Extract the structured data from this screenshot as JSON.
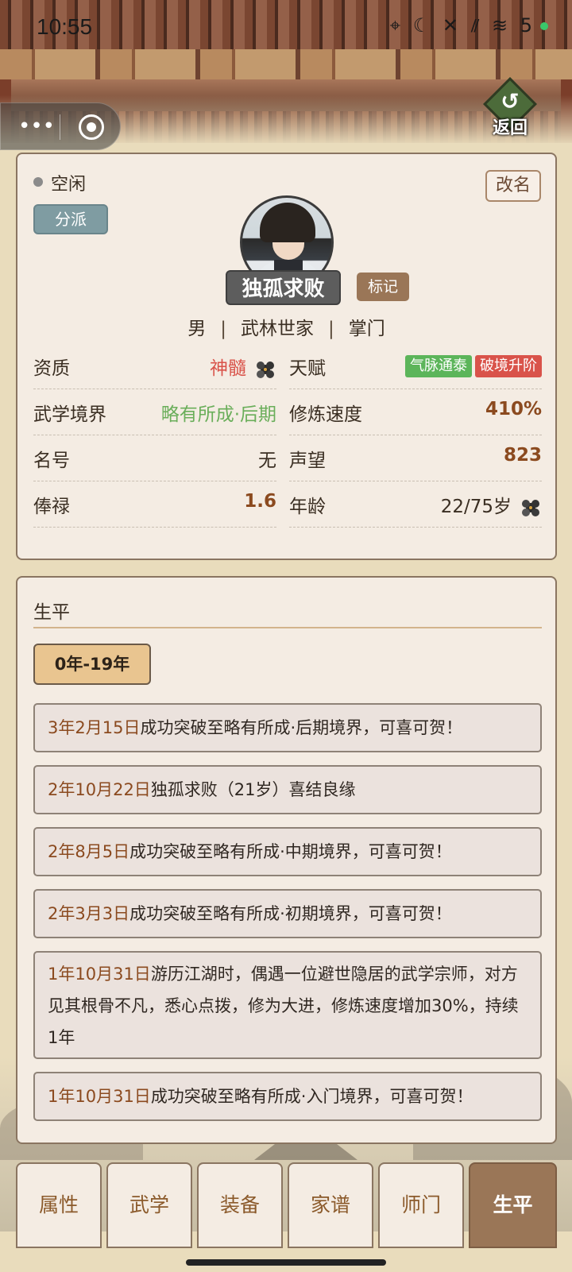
{
  "status_bar": {
    "time": "10:55",
    "icons": "⌖ ☾ ✕ ⫽ ≋ 5"
  },
  "top": {
    "back_label": "返回",
    "back_arrow": "↺"
  },
  "profile": {
    "status": "空闲",
    "faction_button": "分派",
    "rename_button": "改名",
    "name": "独孤求败",
    "mark_button": "标记",
    "gender": "男",
    "origin": "武林世家",
    "role": "掌门",
    "separator": "|"
  },
  "stats": {
    "aptitude": {
      "label": "资质",
      "value": "神髓"
    },
    "talent": {
      "label": "天赋",
      "tags": [
        "气脉通泰",
        "破境升阶"
      ]
    },
    "realm": {
      "label": "武学境界",
      "value": "略有所成·后期"
    },
    "speed": {
      "label": "修炼速度",
      "value": "410%"
    },
    "title": {
      "label": "名号",
      "value": "无"
    },
    "prestige": {
      "label": "声望",
      "value": "823"
    },
    "salary": {
      "label": "俸禄",
      "value": "1.6"
    },
    "age": {
      "label": "年龄",
      "value": "22/75岁"
    }
  },
  "biography": {
    "title": "生平",
    "range_button": "0年-19年",
    "events": [
      {
        "date": "3年2月15日",
        "text": "成功突破至略有所成·后期境界，可喜可贺！"
      },
      {
        "date": "2年10月22日",
        "text": "独孤求败（21岁）喜结良缘"
      },
      {
        "date": "2年8月5日",
        "text": "成功突破至略有所成·中期境界，可喜可贺！"
      },
      {
        "date": "2年3月3日",
        "text": "成功突破至略有所成·初期境界，可喜可贺！"
      },
      {
        "date": "1年10月31日",
        "text": "游历江湖时，偶遇一位避世隐居的武学宗师，对方见其根骨不凡，悉心点拨，修为大进，修炼速度增加30%，持续1年"
      },
      {
        "date": "1年10月31日",
        "text": "成功突破至略有所成·入门境界，可喜可贺！"
      }
    ]
  },
  "tabs": [
    "属性",
    "武学",
    "装备",
    "家谱",
    "师门",
    "生平"
  ],
  "colors": {
    "accent_brown": "#8b4a1f",
    "active_tab": "#9a7657",
    "card_bg": "#f4ece3"
  }
}
